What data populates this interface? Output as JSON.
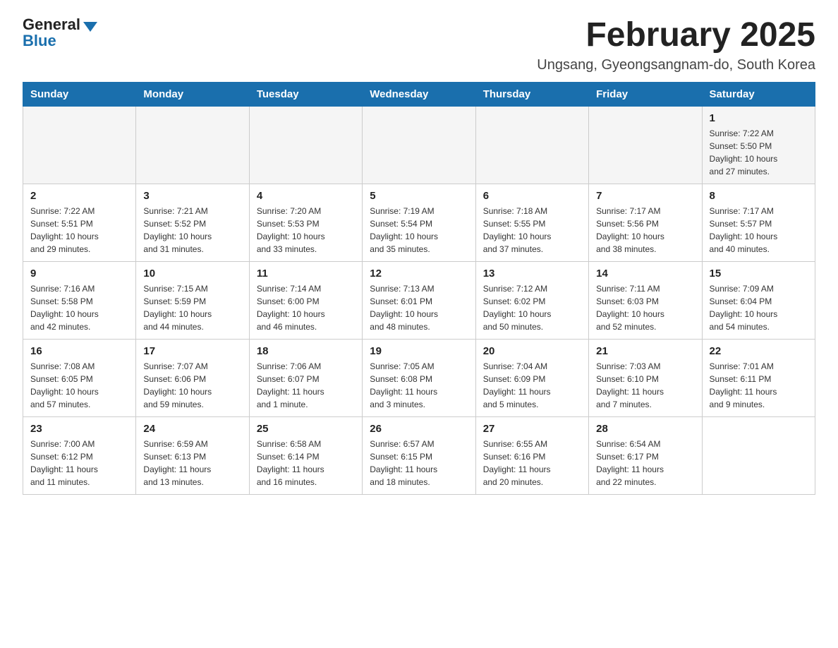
{
  "logo": {
    "general": "General",
    "blue": "Blue"
  },
  "title": "February 2025",
  "subtitle": "Ungsang, Gyeongsangnam-do, South Korea",
  "weekdays": [
    "Sunday",
    "Monday",
    "Tuesday",
    "Wednesday",
    "Thursday",
    "Friday",
    "Saturday"
  ],
  "weeks": [
    [
      {
        "day": "",
        "info": ""
      },
      {
        "day": "",
        "info": ""
      },
      {
        "day": "",
        "info": ""
      },
      {
        "day": "",
        "info": ""
      },
      {
        "day": "",
        "info": ""
      },
      {
        "day": "",
        "info": ""
      },
      {
        "day": "1",
        "info": "Sunrise: 7:22 AM\nSunset: 5:50 PM\nDaylight: 10 hours\nand 27 minutes."
      }
    ],
    [
      {
        "day": "2",
        "info": "Sunrise: 7:22 AM\nSunset: 5:51 PM\nDaylight: 10 hours\nand 29 minutes."
      },
      {
        "day": "3",
        "info": "Sunrise: 7:21 AM\nSunset: 5:52 PM\nDaylight: 10 hours\nand 31 minutes."
      },
      {
        "day": "4",
        "info": "Sunrise: 7:20 AM\nSunset: 5:53 PM\nDaylight: 10 hours\nand 33 minutes."
      },
      {
        "day": "5",
        "info": "Sunrise: 7:19 AM\nSunset: 5:54 PM\nDaylight: 10 hours\nand 35 minutes."
      },
      {
        "day": "6",
        "info": "Sunrise: 7:18 AM\nSunset: 5:55 PM\nDaylight: 10 hours\nand 37 minutes."
      },
      {
        "day": "7",
        "info": "Sunrise: 7:17 AM\nSunset: 5:56 PM\nDaylight: 10 hours\nand 38 minutes."
      },
      {
        "day": "8",
        "info": "Sunrise: 7:17 AM\nSunset: 5:57 PM\nDaylight: 10 hours\nand 40 minutes."
      }
    ],
    [
      {
        "day": "9",
        "info": "Sunrise: 7:16 AM\nSunset: 5:58 PM\nDaylight: 10 hours\nand 42 minutes."
      },
      {
        "day": "10",
        "info": "Sunrise: 7:15 AM\nSunset: 5:59 PM\nDaylight: 10 hours\nand 44 minutes."
      },
      {
        "day": "11",
        "info": "Sunrise: 7:14 AM\nSunset: 6:00 PM\nDaylight: 10 hours\nand 46 minutes."
      },
      {
        "day": "12",
        "info": "Sunrise: 7:13 AM\nSunset: 6:01 PM\nDaylight: 10 hours\nand 48 minutes."
      },
      {
        "day": "13",
        "info": "Sunrise: 7:12 AM\nSunset: 6:02 PM\nDaylight: 10 hours\nand 50 minutes."
      },
      {
        "day": "14",
        "info": "Sunrise: 7:11 AM\nSunset: 6:03 PM\nDaylight: 10 hours\nand 52 minutes."
      },
      {
        "day": "15",
        "info": "Sunrise: 7:09 AM\nSunset: 6:04 PM\nDaylight: 10 hours\nand 54 minutes."
      }
    ],
    [
      {
        "day": "16",
        "info": "Sunrise: 7:08 AM\nSunset: 6:05 PM\nDaylight: 10 hours\nand 57 minutes."
      },
      {
        "day": "17",
        "info": "Sunrise: 7:07 AM\nSunset: 6:06 PM\nDaylight: 10 hours\nand 59 minutes."
      },
      {
        "day": "18",
        "info": "Sunrise: 7:06 AM\nSunset: 6:07 PM\nDaylight: 11 hours\nand 1 minute."
      },
      {
        "day": "19",
        "info": "Sunrise: 7:05 AM\nSunset: 6:08 PM\nDaylight: 11 hours\nand 3 minutes."
      },
      {
        "day": "20",
        "info": "Sunrise: 7:04 AM\nSunset: 6:09 PM\nDaylight: 11 hours\nand 5 minutes."
      },
      {
        "day": "21",
        "info": "Sunrise: 7:03 AM\nSunset: 6:10 PM\nDaylight: 11 hours\nand 7 minutes."
      },
      {
        "day": "22",
        "info": "Sunrise: 7:01 AM\nSunset: 6:11 PM\nDaylight: 11 hours\nand 9 minutes."
      }
    ],
    [
      {
        "day": "23",
        "info": "Sunrise: 7:00 AM\nSunset: 6:12 PM\nDaylight: 11 hours\nand 11 minutes."
      },
      {
        "day": "24",
        "info": "Sunrise: 6:59 AM\nSunset: 6:13 PM\nDaylight: 11 hours\nand 13 minutes."
      },
      {
        "day": "25",
        "info": "Sunrise: 6:58 AM\nSunset: 6:14 PM\nDaylight: 11 hours\nand 16 minutes."
      },
      {
        "day": "26",
        "info": "Sunrise: 6:57 AM\nSunset: 6:15 PM\nDaylight: 11 hours\nand 18 minutes."
      },
      {
        "day": "27",
        "info": "Sunrise: 6:55 AM\nSunset: 6:16 PM\nDaylight: 11 hours\nand 20 minutes."
      },
      {
        "day": "28",
        "info": "Sunrise: 6:54 AM\nSunset: 6:17 PM\nDaylight: 11 hours\nand 22 minutes."
      },
      {
        "day": "",
        "info": ""
      }
    ]
  ]
}
